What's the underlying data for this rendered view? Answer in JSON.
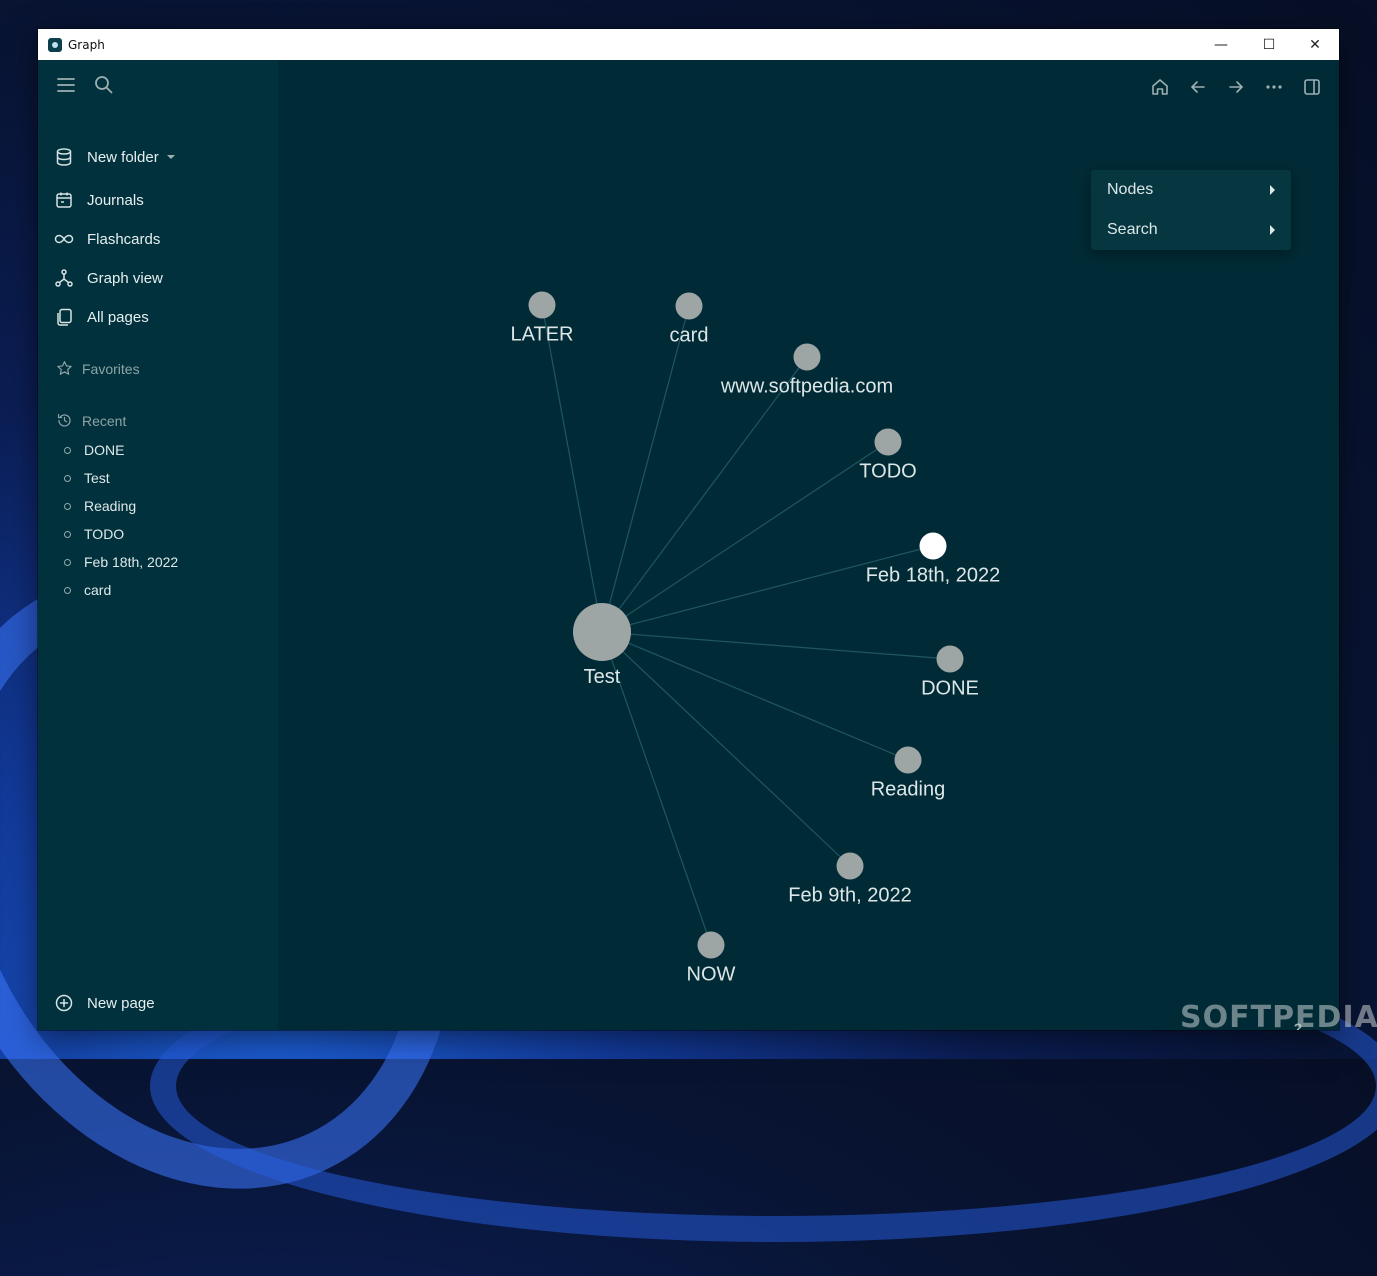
{
  "window": {
    "title": "Graph"
  },
  "sidebar": {
    "folder": "New folder",
    "nav": [
      "Journals",
      "Flashcards",
      "Graph view",
      "All pages"
    ],
    "favorites_label": "Favorites",
    "recent_label": "Recent",
    "recent": [
      "DONE",
      "Test",
      "Reading",
      "TODO",
      "Feb 18th, 2022",
      "card"
    ],
    "new_page": "New page"
  },
  "menu": {
    "items": [
      "Nodes",
      "Search"
    ]
  },
  "graph": {
    "center": "Test",
    "nodes": [
      "LATER",
      "card",
      "www.softpedia.com",
      "TODO",
      "Feb 18th, 2022",
      "DONE",
      "Reading",
      "Feb 9th, 2022",
      "NOW"
    ],
    "highlighted": "Feb 18th, 2022",
    "colors": {
      "node": "#9da5a5",
      "highlight": "#ffffff",
      "edge": "#1f5660",
      "label": "#dde6e6"
    }
  },
  "help": "?",
  "watermark": "SOFTPEDIA"
}
